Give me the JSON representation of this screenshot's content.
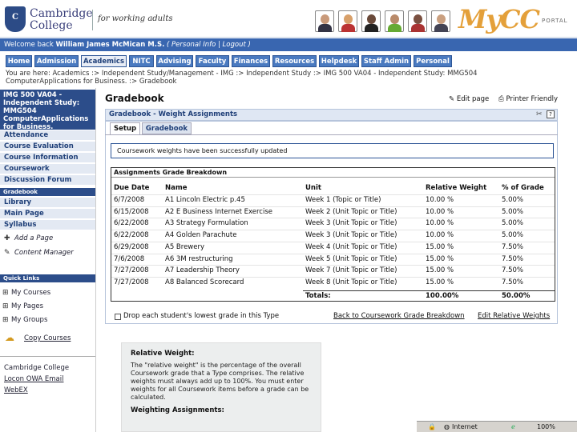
{
  "header": {
    "logo_top": "Cambridge",
    "logo_bottom": "College",
    "crest_letter": "C",
    "tagline": "for working adults",
    "portal_logo": "MyCC",
    "portal_sub": "PORTAL"
  },
  "welcome": {
    "prefix": "Welcome back ",
    "user": "William James McMican M.S.",
    "links": "( Personal Info | Logout )"
  },
  "tabs": [
    "Home",
    "Admission",
    "Academics",
    "NITC",
    "Advising",
    "Faculty",
    "Finances",
    "Resources",
    "Helpdesk",
    "Staff Admin",
    "Personal"
  ],
  "breadcrumb": "You are here:  Academics :> Independent Study/Management - IMG :> Independent Study :> IMG 500 VA04 - Independent Study: MMG504 ComputerApplications for Business. :> Gradebook",
  "sidebar": {
    "course": "IMG 500 VA04 - Independent Study: MMG504 ComputerApplications for Business.",
    "items": [
      "Attendance",
      "Course Evaluation",
      "Course Information",
      "Coursework",
      "Discussion Forum"
    ],
    "gradebook_head": "Gradebook",
    "items2": [
      "Library",
      "Main Page",
      "Syllabus"
    ],
    "tools": [
      "Add a Page",
      "Content Manager"
    ],
    "quicklinks_head": "Quick Links",
    "quicklinks": [
      "My Courses",
      "My Pages",
      "My Groups"
    ],
    "copy_courses": "Copy Courses",
    "bottom_links": [
      "Cambridge College",
      "Locon OWA Email",
      "WebEX"
    ]
  },
  "main": {
    "title": "Gradebook",
    "edit_page": "Edit page",
    "printer_friendly": "Printer Friendly",
    "panel_title": "Gradebook - Weight Assignments",
    "tab_setup": "Setup",
    "tab_gradebook": "Gradebook",
    "success": "Coursework weights have been successfully updated",
    "table_caption": "Assignments Grade Breakdown",
    "columns": [
      "Due Date",
      "Name",
      "Unit",
      "Relative Weight",
      "% of Grade"
    ],
    "rows": [
      [
        "6/7/2008",
        "A1 Lincoln Electric p.45",
        "Week 1 (Topic or Title)",
        "10.00 %",
        "5.00%"
      ],
      [
        "6/15/2008",
        "A2 E Business Internet Exercise",
        "Week 2 (Unit Topic or Title)",
        "10.00 %",
        "5.00%"
      ],
      [
        "6/22/2008",
        "A3 Strategy Formulation",
        "Week 3 (Unit Topic or Title)",
        "10.00 %",
        "5.00%"
      ],
      [
        "6/22/2008",
        "A4 Golden Parachute",
        "Week 3 (Unit Topic or Title)",
        "10.00 %",
        "5.00%"
      ],
      [
        "6/29/2008",
        "A5 Brewery",
        "Week 4 (Unit Topic or Title)",
        "15.00 %",
        "7.50%"
      ],
      [
        "7/6/2008",
        "A6 3M restructuring",
        "Week 5 (Unit Topic or Title)",
        "15.00 %",
        "7.50%"
      ],
      [
        "7/27/2008",
        "A7 Leadership Theory",
        "Week 7 (Unit Topic or Title)",
        "15.00 %",
        "7.50%"
      ],
      [
        "7/27/2008",
        "A8 Balanced Scorecard",
        "Week 8 (Unit Topic or Title)",
        "15.00 %",
        "7.50%"
      ]
    ],
    "totals_label": "Totals:",
    "totals_weight": "100.00%",
    "totals_grade": "50.00%",
    "drop_label": "Drop each student's lowest grade in this Type",
    "back_link": "Back to Coursework Grade Breakdown",
    "edit_weights": "Edit Relative Weights",
    "help": {
      "title": "Relative Weight:",
      "body": "The \"relative weight\" is the percentage of the overall Coursework grade that a Type comprises. The relative weights must always add up to 100%. You must enter weights for all Coursework items before a grade can be calculated.",
      "title2": "Weighting Assignments:"
    }
  },
  "statusbar": {
    "zone": "Internet",
    "zoom": "100%"
  }
}
